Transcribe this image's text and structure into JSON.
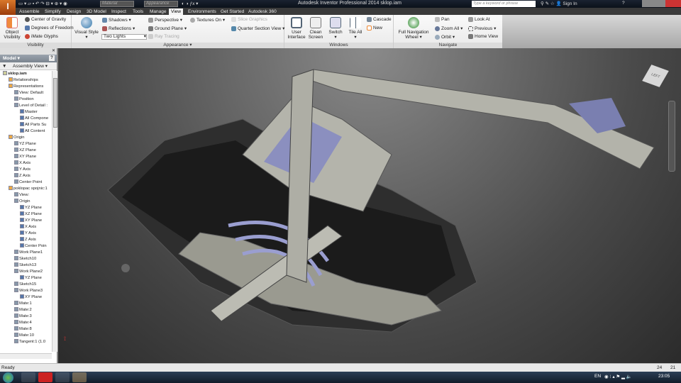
{
  "title_bar": {
    "app_button": "I",
    "app_sub": "PRO",
    "title": "Autodesk Inventor Professional 2014   sklop.iam",
    "material": "Material",
    "appearance": "Appearance",
    "search_placeholder": "Type a keyword or phrase",
    "sign_in": "Sign In"
  },
  "tabs": [
    "Assemble",
    "Simplify",
    "Design",
    "3D Model",
    "Inspect",
    "Tools",
    "Manage",
    "View",
    "Environments",
    "Get Started",
    "Autodesk 360"
  ],
  "active_tab": "View",
  "ribbon": {
    "visibility": {
      "label": "Visibility",
      "object_visibility": "Object Visibility",
      "center_of_gravity": "Center of Gravity",
      "degrees_of_freedom": "Degrees of Freedom",
      "imate_glyphs": "iMate Glyphs"
    },
    "appearance": {
      "label": "Appearance",
      "visual_style": "Visual Style",
      "shadows": "Shadows",
      "reflections": "Reflections",
      "lighting": "Two Lights",
      "perspective": "Perspective",
      "ground_plane": "Ground Plane",
      "ray_tracing": "Ray Tracing",
      "textures_on": "Textures On",
      "slice_graphics": "Slice Graphics",
      "quarter_section_view": "Quarter Section View"
    },
    "windows": {
      "label": "Windows",
      "user_interface": "User Interface",
      "clean_screen": "Clean Screen",
      "switch": "Switch",
      "tile_all": "Tile All",
      "cascade": "Cascade",
      "new": "New"
    },
    "navigate": {
      "label": "Navigate",
      "full_nav_wheel": "Full Navigation Wheel",
      "pan": "Pan",
      "zoom_all": "Zoom All",
      "orbit": "Orbit",
      "look_at": "Look At",
      "previous": "Previous",
      "home_view": "Home View"
    }
  },
  "browser": {
    "tab": "Model",
    "view": "Assembly View",
    "tree": [
      {
        "label": "sklop.iam",
        "level": 0,
        "bold": true
      },
      {
        "label": "Relationships",
        "level": 1
      },
      {
        "label": "Representations",
        "level": 1
      },
      {
        "label": "View: Default",
        "level": 2
      },
      {
        "label": "Position",
        "level": 2
      },
      {
        "label": "Level of Detail :",
        "level": 2
      },
      {
        "label": "Master",
        "level": 3
      },
      {
        "label": "All Compone",
        "level": 3
      },
      {
        "label": "All Parts Su",
        "level": 3
      },
      {
        "label": "All Content",
        "level": 3
      },
      {
        "label": "Origin",
        "level": 1
      },
      {
        "label": "YZ Plane",
        "level": 2
      },
      {
        "label": "XZ Plane",
        "level": 2
      },
      {
        "label": "XY Plane",
        "level": 2
      },
      {
        "label": "X Axis",
        "level": 2
      },
      {
        "label": "Y Axis",
        "level": 2
      },
      {
        "label": "Z Axis",
        "level": 2
      },
      {
        "label": "Center Point",
        "level": 2
      },
      {
        "label": "poklopac spojnic:1",
        "level": 1
      },
      {
        "label": "View:",
        "level": 2
      },
      {
        "label": "Origin",
        "level": 2
      },
      {
        "label": "YZ Plane",
        "level": 3
      },
      {
        "label": "XZ Plane",
        "level": 3
      },
      {
        "label": "XY Plane",
        "level": 3
      },
      {
        "label": "X Axis",
        "level": 3
      },
      {
        "label": "Y Axis",
        "level": 3
      },
      {
        "label": "Z Axis",
        "level": 3
      },
      {
        "label": "Center Poin",
        "level": 3
      },
      {
        "label": "Work Plane1",
        "level": 2
      },
      {
        "label": "Sketch10",
        "level": 2
      },
      {
        "label": "Sketch13",
        "level": 2
      },
      {
        "label": "Work Plane2",
        "level": 2
      },
      {
        "label": "YZ Plane",
        "level": 3
      },
      {
        "label": "Sketch15",
        "level": 2
      },
      {
        "label": "Work Plane3",
        "level": 2
      },
      {
        "label": "XY Plane",
        "level": 3
      },
      {
        "label": "Mate:1",
        "level": 2
      },
      {
        "label": "Mate:2",
        "level": 2
      },
      {
        "label": "Mate:3",
        "level": 2
      },
      {
        "label": "Mate:4",
        "level": 2
      },
      {
        "label": "Mate:8",
        "level": 2
      },
      {
        "label": "Mate:10",
        "level": 2
      },
      {
        "label": "Tangent:1 (1.0",
        "level": 2
      }
    ]
  },
  "viewcube_label": "LEFT",
  "status": {
    "text": "Ready",
    "n1": "24",
    "n2": "21"
  },
  "taskbar": {
    "lang": "EN",
    "clock": "23:05"
  }
}
